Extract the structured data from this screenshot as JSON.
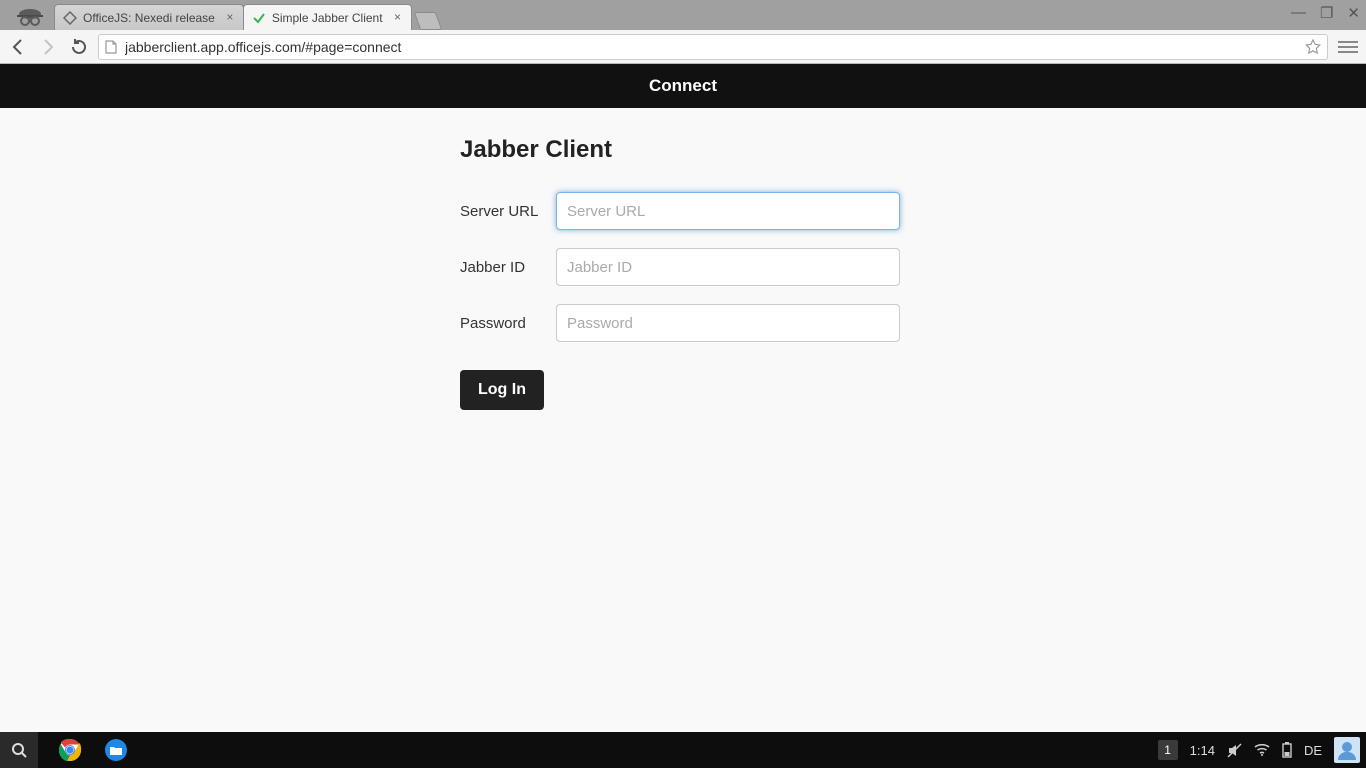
{
  "browser": {
    "tabs": [
      {
        "title": "OfficeJS: Nexedi release",
        "active": false
      },
      {
        "title": "Simple Jabber Client",
        "active": true
      }
    ],
    "url": "jabberclient.app.officejs.com/#page=connect"
  },
  "page": {
    "header_title": "Connect",
    "heading": "Jabber Client",
    "fields": {
      "server_url": {
        "label": "Server URL",
        "placeholder": "Server URL",
        "value": ""
      },
      "jabber_id": {
        "label": "Jabber ID",
        "placeholder": "Jabber ID",
        "value": ""
      },
      "password": {
        "label": "Password",
        "placeholder": "Password",
        "value": ""
      }
    },
    "login_button": "Log In"
  },
  "taskbar": {
    "notification_count": "1",
    "clock": "1:14",
    "keyboard_layout": "DE"
  }
}
